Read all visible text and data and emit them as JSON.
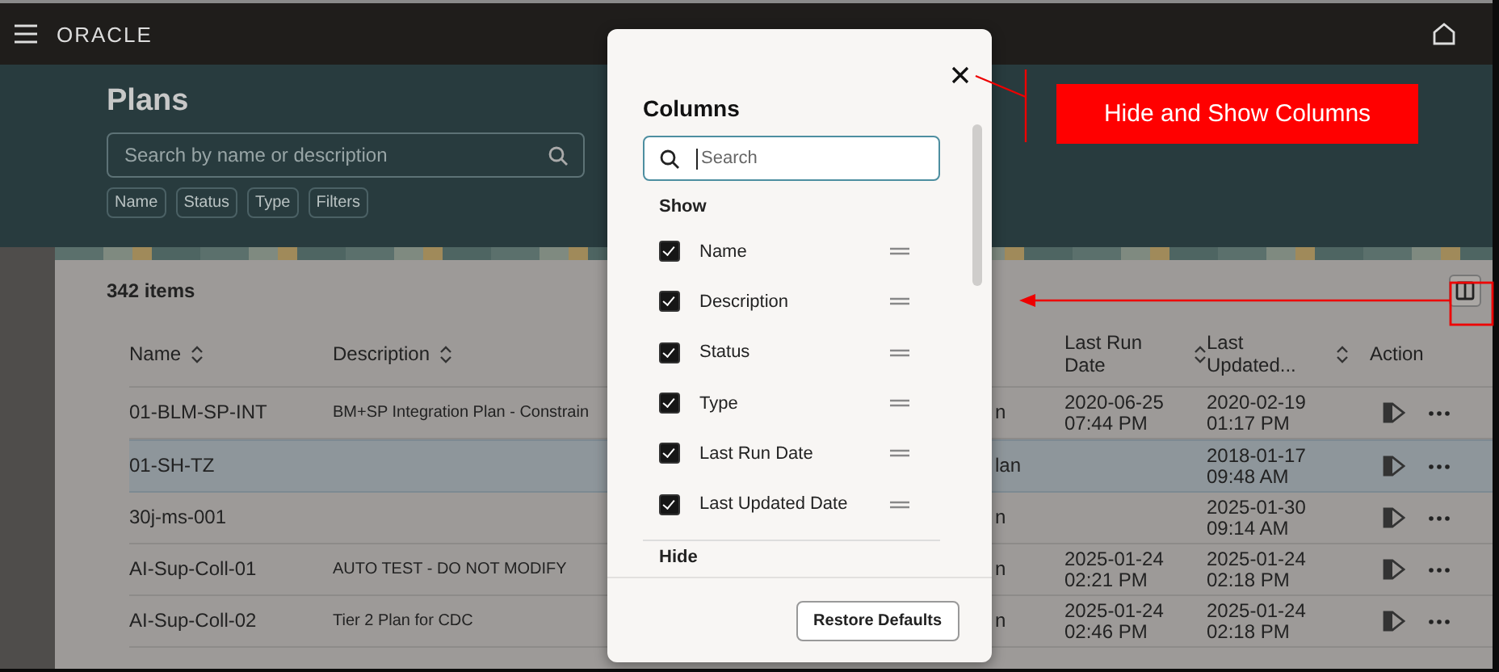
{
  "header": {
    "logo": "ORACLE"
  },
  "page": {
    "title": "Plans",
    "search": {
      "placeholder": "Search by name or description"
    },
    "filters": [
      "Name",
      "Status",
      "Type",
      "Filters"
    ]
  },
  "table": {
    "count": "342 items",
    "columns": [
      {
        "label": "Name",
        "sortable": true
      },
      {
        "label": "Description",
        "sortable": true
      },
      {
        "label": "Last Run Date",
        "sortable": true
      },
      {
        "label": "Last Updated...",
        "sortable": true
      },
      {
        "label": "Action",
        "sortable": false
      }
    ],
    "rows": [
      {
        "name": "01-BLM-SP-INT",
        "description": "BM+SP Integration Plan - Constrain",
        "column_5": "n",
        "last_run": "2020-06-25 07:44 PM",
        "last_updated": "2020-02-19 01:17 PM",
        "selected": false
      },
      {
        "name": "01-SH-TZ",
        "column_5": "lan",
        "last_updated": "2018-01-17 09:48 AM",
        "selected": true
      },
      {
        "name": "30j-ms-001",
        "column_5": "n",
        "last_updated": "2025-01-30 09:14 AM",
        "selected": false
      },
      {
        "name": "AI-Sup-Coll-01",
        "description": "AUTO TEST - DO NOT MODIFY",
        "column_5": "n",
        "last_run": "2025-01-24 02:21 PM",
        "last_updated": "2025-01-24 02:18 PM",
        "selected": false
      },
      {
        "name": "AI-Sup-Coll-02",
        "description": "Tier 2 Plan for CDC",
        "column_5": "n",
        "last_run": "2025-01-24 02:46 PM",
        "last_updated": "2025-01-24 02:18 PM",
        "selected": false
      }
    ]
  },
  "dialog": {
    "title": "Columns",
    "search": {
      "placeholder": "Search"
    },
    "show_heading": "Show",
    "items": [
      {
        "label": "Name",
        "checked": true
      },
      {
        "label": "Description",
        "checked": true
      },
      {
        "label": "Status",
        "checked": true
      },
      {
        "label": "Type",
        "checked": true
      },
      {
        "label": "Last Run Date",
        "checked": true
      },
      {
        "label": "Last Updated Date",
        "checked": true
      }
    ],
    "hide_heading": "Hide",
    "button": "Restore Defaults"
  },
  "annotation": {
    "label": "Hide and Show Columns"
  }
}
